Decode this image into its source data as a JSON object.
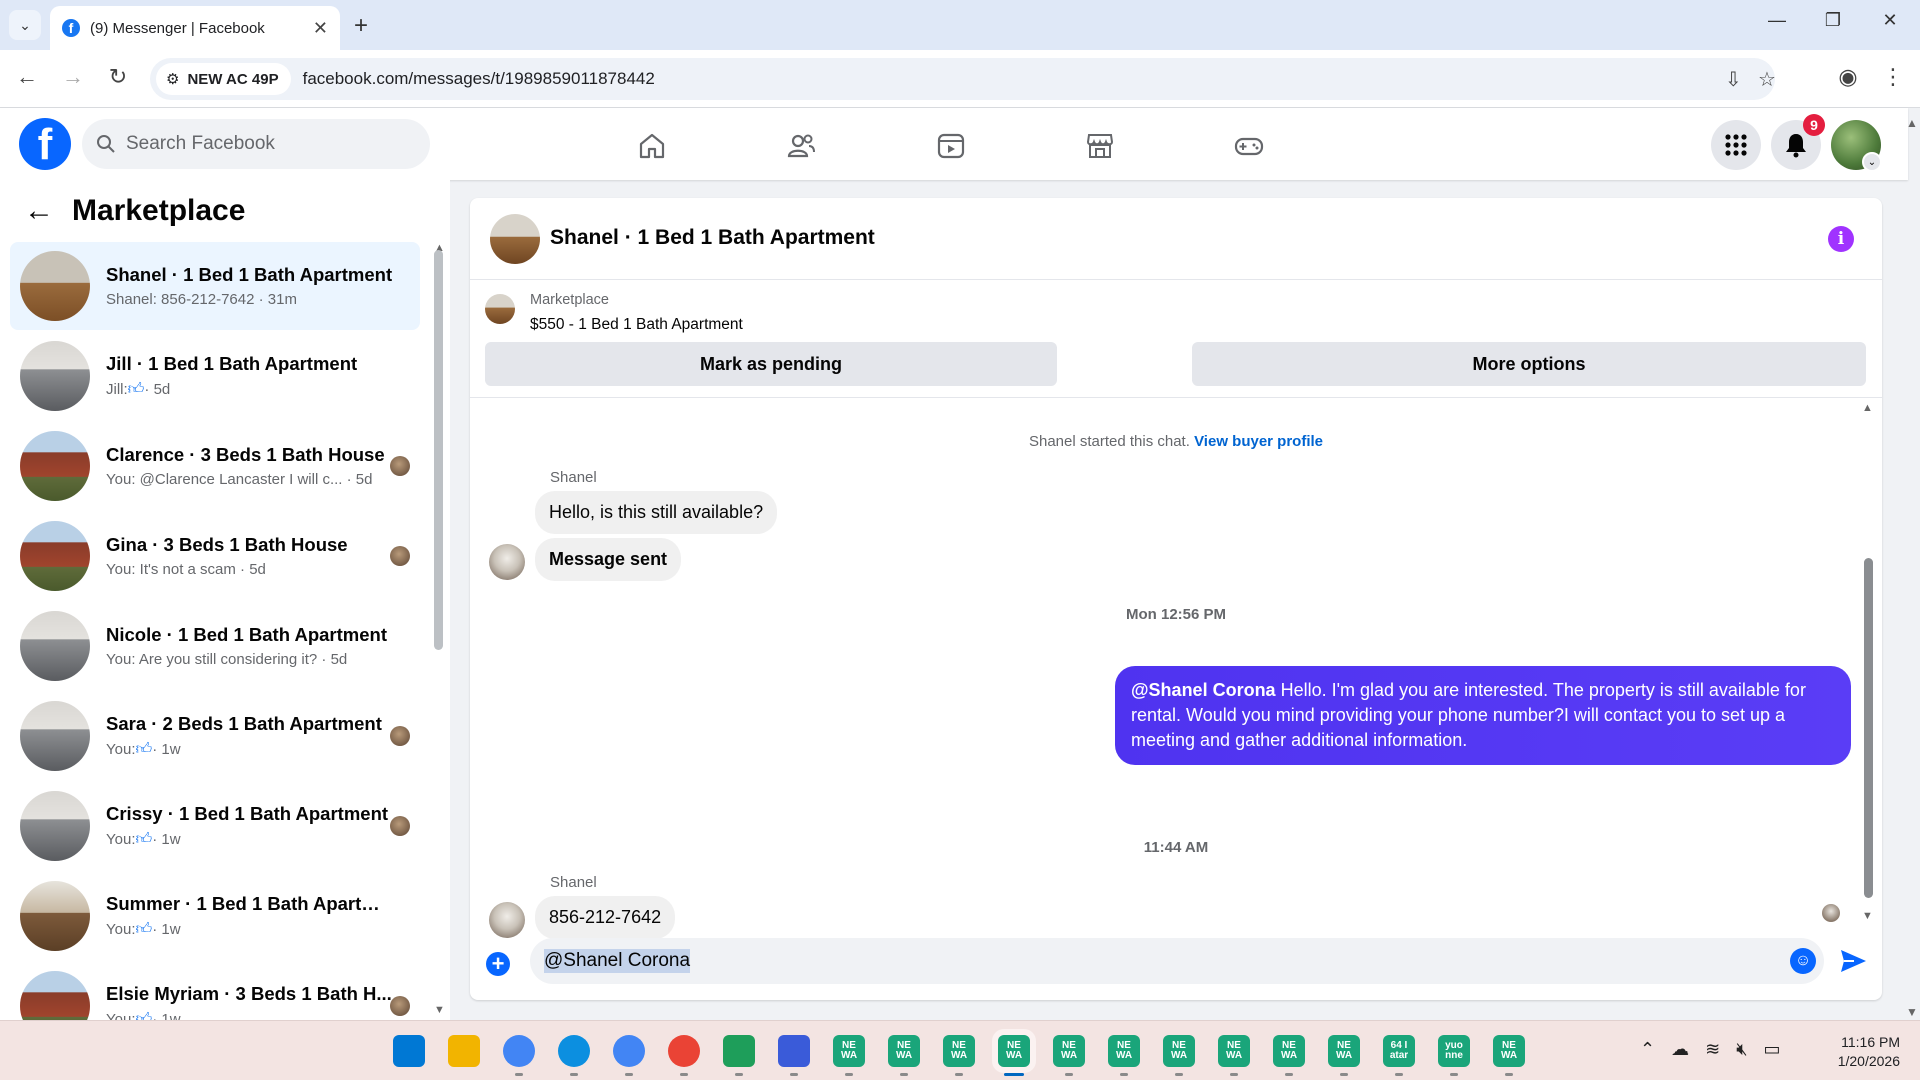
{
  "browser": {
    "tab_title": "(9) Messenger | Facebook",
    "site_chip": "NEW AC 49P",
    "url": "facebook.com/messages/t/1989859011878442"
  },
  "fb_header": {
    "search_placeholder": "Search Facebook",
    "notification_count": "9"
  },
  "sidebar": {
    "title": "Marketplace",
    "conversations": [
      {
        "name": "Shanel · 1 Bed 1 Bath Apartment",
        "preview": "Shanel: 856-212-7642 · 31m",
        "thumb": "room",
        "active": true,
        "receipt": false
      },
      {
        "name": "Jill · 1 Bed 1 Bath Apartment",
        "preview_prefix": "Jill:",
        "preview_suffix": "· 5d",
        "thumb": "kitchen",
        "like": true,
        "receipt": false
      },
      {
        "name": "Clarence · 3 Beds 1 Bath House",
        "preview": "You: @Clarence Lancaster I will c... · 5d",
        "thumb": "house",
        "receipt": true
      },
      {
        "name": "Gina · 3 Beds 1 Bath House",
        "preview": "You: It's not a scam · 5d",
        "thumb": "house",
        "receipt": true
      },
      {
        "name": "Nicole · 1 Bed 1 Bath Apartment",
        "preview": "You: Are you still considering it? · 5d",
        "thumb": "kitchen",
        "receipt": false
      },
      {
        "name": "Sara · 2 Beds 1 Bath Apartment",
        "preview_prefix": "You:",
        "preview_suffix": "· 1w",
        "thumb": "kitchen",
        "like": true,
        "receipt": true
      },
      {
        "name": "Crissy · 1 Bed 1 Bath Apartment",
        "preview_prefix": "You:",
        "preview_suffix": "· 1w",
        "thumb": "kitchen",
        "like": true,
        "receipt": true
      },
      {
        "name": "Summer · 1 Bed 1 Bath Apartment",
        "preview_prefix": "You:",
        "preview_suffix": "· 1w",
        "thumb": "kitchen2",
        "like": true,
        "receipt": false
      },
      {
        "name": "Elsie Myriam · 3 Beds 1 Bath H...",
        "preview_prefix": "You:",
        "preview_suffix": "· 1w",
        "thumb": "house",
        "like": true,
        "receipt": true
      }
    ]
  },
  "chat": {
    "title": "Shanel · 1 Bed 1 Bath Apartment",
    "listing_source": "Marketplace",
    "listing_title": "$550 - 1 Bed 1 Bath Apartment",
    "mark_pending_label": "Mark as pending",
    "more_options_label": "More options",
    "started_text": "Shanel started this chat.",
    "view_profile_link": "View buyer profile",
    "sender_name_1": "Shanel",
    "msg_1": "Hello, is this still available?",
    "msg_2": "Message sent",
    "timestamp_1": "Mon 12:56 PM",
    "outgoing_mention": "@Shanel Corona",
    "outgoing_text": " Hello.  I'm glad you are interested. The property is still available for rental. Would you mind providing your phone number?I will contact you to set up a meeting and gather additional information.",
    "timestamp_2": "11:44 AM",
    "sender_name_2": "Shanel",
    "msg_3": "856-212-7642",
    "composer_text": "@Shanel Corona"
  },
  "taskbar": {
    "apps": [
      {
        "icon": "windows-start-icon",
        "label": ""
      },
      {
        "icon": "file-explorer-icon",
        "label": ""
      },
      {
        "icon": "chrome-icon",
        "label": ""
      },
      {
        "icon": "edge-icon",
        "label": ""
      },
      {
        "icon": "chrome-profile-icon",
        "label": ""
      },
      {
        "icon": "chrome-profile-icon",
        "label": ""
      },
      {
        "icon": "glasses-app-icon",
        "label": ""
      },
      {
        "icon": "proxy-app-icon",
        "label": ""
      },
      {
        "icon": "newa-app-icon",
        "label": "NE WA"
      },
      {
        "icon": "newa-app-icon",
        "label": "NE WA"
      },
      {
        "icon": "newa-app-icon",
        "label": "NE WA"
      },
      {
        "icon": "newa-app-icon",
        "label": "NE WA"
      },
      {
        "icon": "newa-app-icon",
        "label": "NE WA"
      },
      {
        "icon": "newa-app-icon",
        "label": "NE WA"
      },
      {
        "icon": "newa-app-icon",
        "label": "NE WA"
      },
      {
        "icon": "newa-app-icon",
        "label": "NE WA"
      },
      {
        "icon": "newa-app-icon",
        "label": "NE WA"
      },
      {
        "icon": "newa-app-icon",
        "label": "NE WA"
      },
      {
        "icon": "app-icon",
        "label": "64 I atar"
      },
      {
        "icon": "app-icon",
        "label": "yuo nne"
      },
      {
        "icon": "newa-app-icon",
        "label": "NE WA"
      }
    ],
    "time": "11:16 PM",
    "date": "1/20/2026"
  }
}
